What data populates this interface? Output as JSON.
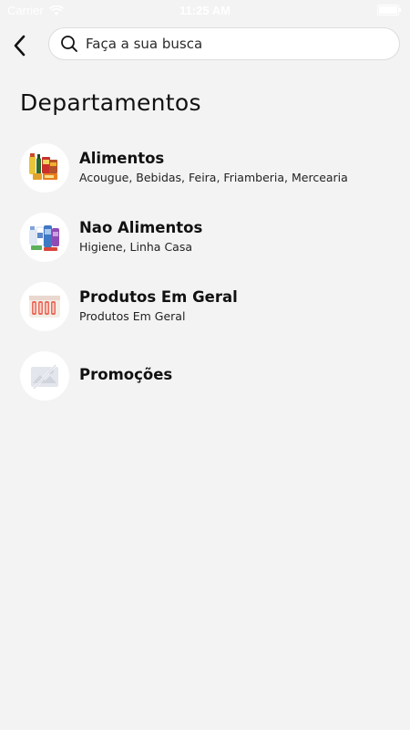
{
  "status_bar": {
    "carrier": "Carrier",
    "time": "11:25 AM"
  },
  "header": {
    "back_icon": "chevron-left-icon",
    "search": {
      "placeholder": "Faça a sua busca",
      "icon": "search-icon"
    }
  },
  "page": {
    "title": "Departamentos"
  },
  "departments": [
    {
      "name": "Alimentos",
      "subtitle": "Acougue, Bebidas, Feira, Friamberia, Mercearia",
      "icon": "grocery-products-icon"
    },
    {
      "name": "Nao Alimentos",
      "subtitle": "Higiene, Linha Casa",
      "icon": "hygiene-products-icon"
    },
    {
      "name": "Produtos Em Geral",
      "subtitle": "Produtos Em Geral",
      "icon": "paper-towel-pack-icon"
    },
    {
      "name": "Promoções",
      "subtitle": "",
      "icon": "image-placeholder-icon"
    }
  ],
  "colors": {
    "background": "#f3f3f3",
    "text": "#111111",
    "search_bg": "#ffffff"
  }
}
